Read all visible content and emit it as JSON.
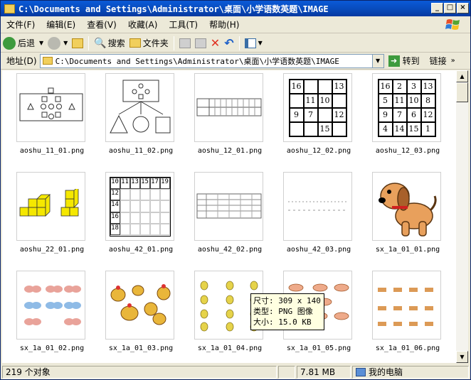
{
  "window": {
    "title": "C:\\Documents and Settings\\Administrator\\桌面\\小学语数英题\\IMAGE"
  },
  "menu": [
    "文件(F)",
    "编辑(E)",
    "查看(V)",
    "收藏(A)",
    "工具(T)",
    "帮助(H)"
  ],
  "toolbar": {
    "back": "后退",
    "search": "搜索",
    "folders": "文件夹"
  },
  "address": {
    "label": "地址(D)",
    "value": "C:\\Documents and Settings\\Administrator\\桌面\\小学语数英题\\IMAGE",
    "go": "转到",
    "links": "链接"
  },
  "files": [
    {
      "name": "aoshu_11_01.png",
      "icon": "shapes-pattern-icon"
    },
    {
      "name": "aoshu_11_02.png",
      "icon": "shapes-diagram-icon"
    },
    {
      "name": "aoshu_12_01.png",
      "icon": "number-table-icon"
    },
    {
      "name": "aoshu_12_02.png",
      "icon": "magic-square-partial-icon"
    },
    {
      "name": "aoshu_12_03.png",
      "icon": "magic-square-full-icon"
    },
    {
      "name": "aoshu_22_01.png",
      "icon": "yellow-cubes-icon"
    },
    {
      "name": "aoshu_42_01.png",
      "icon": "number-grid-icon"
    },
    {
      "name": "aoshu_42_02.png",
      "icon": "number-table-icon"
    },
    {
      "name": "aoshu_42_03.png",
      "icon": "line-sketch-icon"
    },
    {
      "name": "sx_1a_01_01.png",
      "icon": "dog-icon"
    },
    {
      "name": "sx_1a_01_02.png",
      "icon": "butterflies-icon"
    },
    {
      "name": "sx_1a_01_03.png",
      "icon": "chickens-icon"
    },
    {
      "name": "sx_1a_01_04.png",
      "icon": "pears-icon"
    },
    {
      "name": "sx_1a_01_05.png",
      "icon": "birds-icon"
    },
    {
      "name": "sx_1a_01_06.png",
      "icon": "deer-icon"
    }
  ],
  "magic_square_partial": [
    "16",
    "",
    "",
    "13",
    "",
    "11",
    "10",
    "",
    "9",
    "7",
    "",
    "12",
    "",
    "",
    "15",
    ""
  ],
  "magic_square_full": [
    "16",
    "2",
    "3",
    "13",
    "5",
    "11",
    "10",
    "8",
    "9",
    "7",
    "6",
    "12",
    "4",
    "14",
    "15",
    "1"
  ],
  "number_grid": {
    "header": [
      "10",
      "11",
      "13",
      "15",
      "17",
      "19"
    ],
    "side": [
      "12",
      "14",
      "16",
      "18"
    ]
  },
  "tooltip": {
    "size": "尺寸: 309 x 140",
    "type": "类型: PNG 图像",
    "filesize": "大小: 15.0 KB"
  },
  "status": {
    "count": "219 个对象",
    "size": "7.81 MB",
    "location": "我的电脑"
  }
}
